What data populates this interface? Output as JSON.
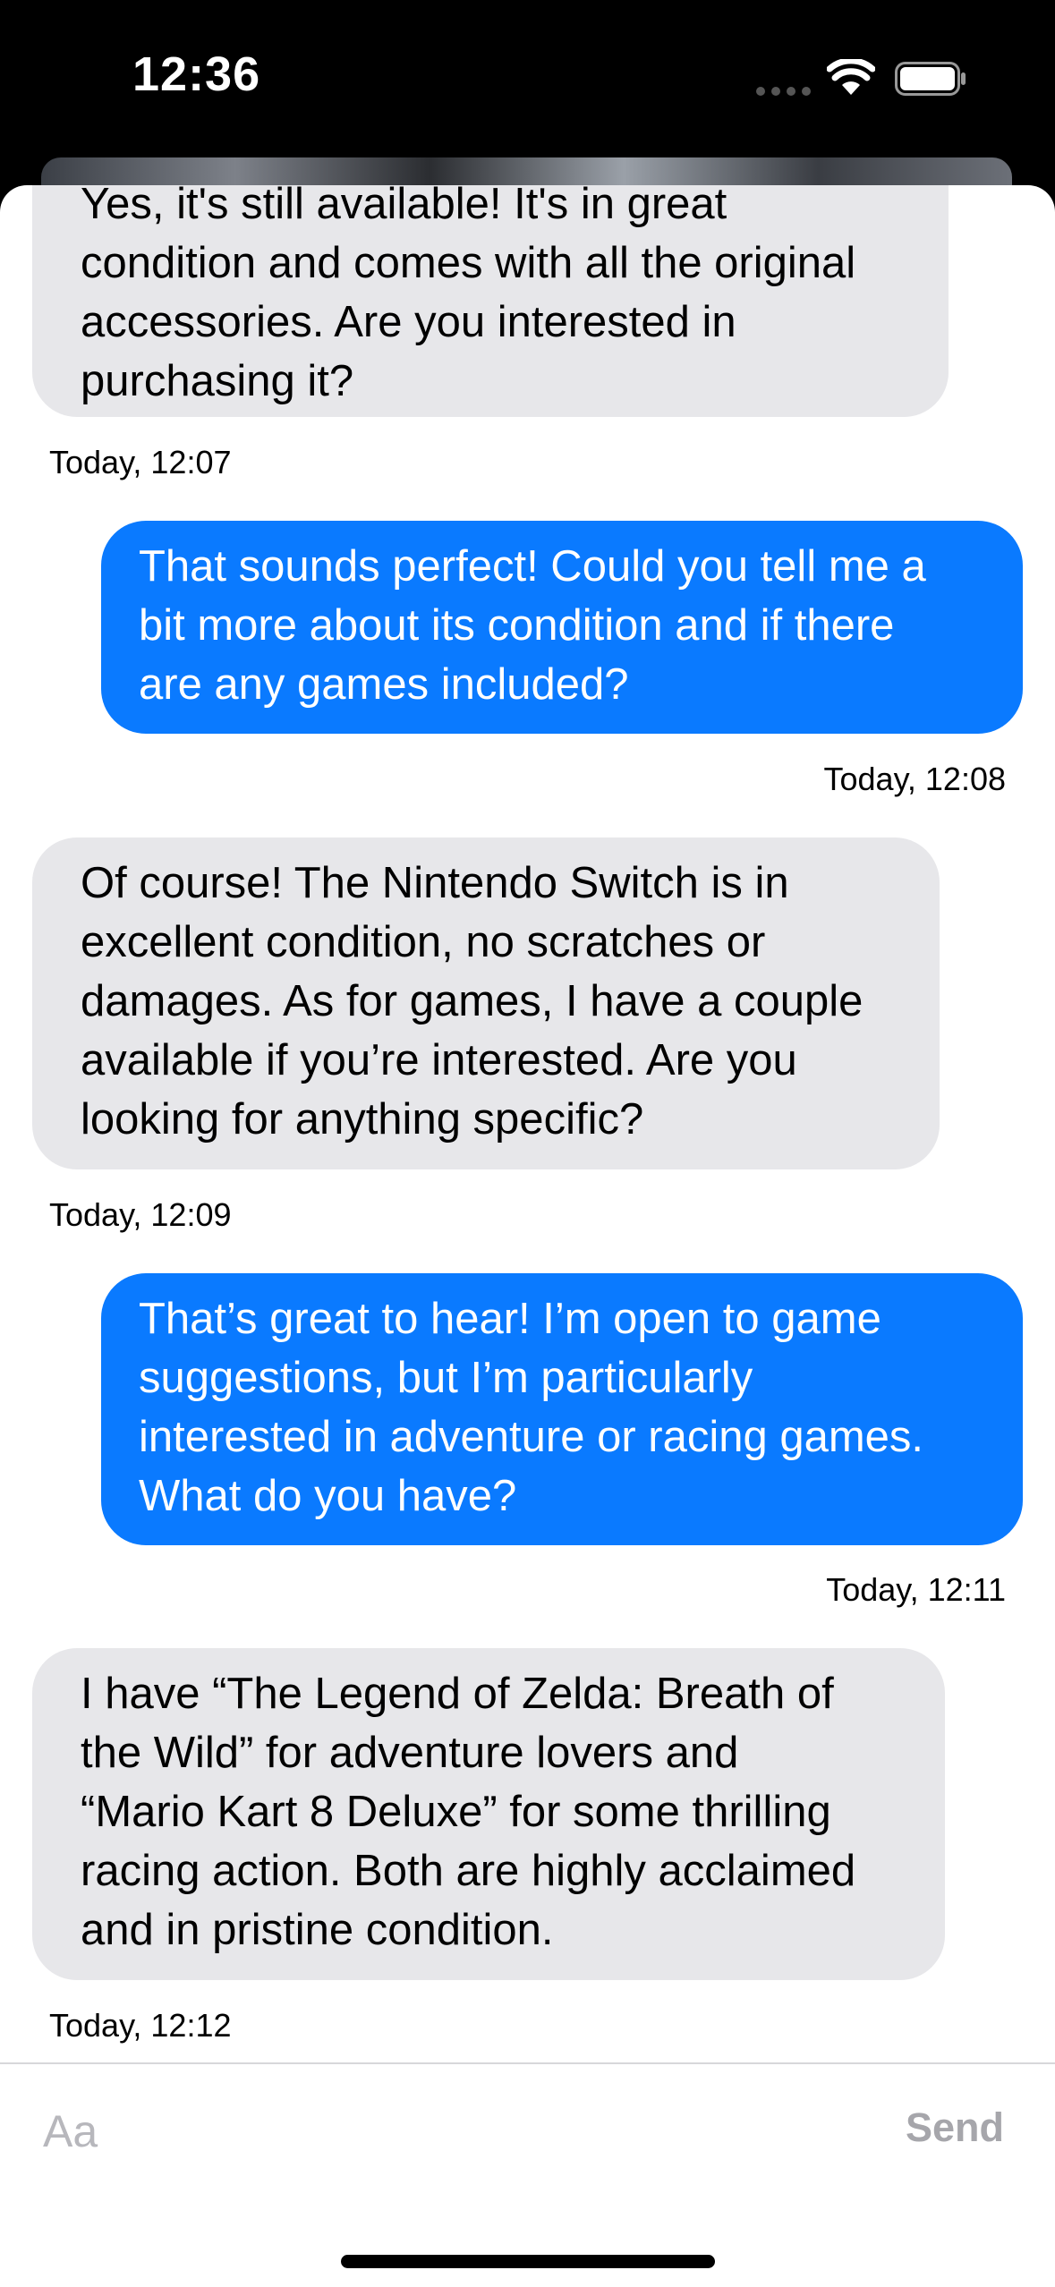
{
  "status_bar": {
    "time": "12:36"
  },
  "messages": [
    {
      "direction": "incoming",
      "lines": [
        "Yes, it's still available! It's in great",
        "condition and comes with all the original",
        "accessories. Are you interested in",
        "purchasing it?"
      ],
      "timestamp": "Today, 12:07"
    },
    {
      "direction": "outgoing",
      "lines": [
        "That sounds perfect! Could you tell me a",
        "bit more about its condition and if there",
        "are any games included?"
      ],
      "timestamp": "Today, 12:08"
    },
    {
      "direction": "incoming",
      "lines": [
        "Of course! The Nintendo Switch is in",
        "excellent condition, no scratches or",
        "damages. As for games, I have a couple",
        "available if you’re interested. Are you",
        "looking for anything specific?"
      ],
      "timestamp": "Today, 12:09"
    },
    {
      "direction": "outgoing",
      "lines": [
        "That’s great to hear! I’m open to game",
        "suggestions, but I’m particularly",
        "interested in adventure or racing games.",
        "What do you have?"
      ],
      "timestamp": "Today, 12:11"
    },
    {
      "direction": "incoming",
      "lines": [
        "I have “The Legend of Zelda: Breath of",
        "the Wild” for adventure lovers and",
        "“Mario Kart 8 Deluxe” for some thrilling",
        "racing action. Both are highly acclaimed",
        "and in pristine condition."
      ],
      "timestamp": "Today, 12:12"
    }
  ],
  "composer": {
    "placeholder": "Aa",
    "value": "",
    "send_label": "Send"
  },
  "colors": {
    "outgoing_bubble": "#0a7aff",
    "incoming_bubble": "#e7e7ea",
    "send_disabled": "#a6a6ab"
  },
  "icons": {
    "signal": "cellular-signal-icon",
    "wifi": "wifi-icon",
    "battery": "battery-icon"
  }
}
